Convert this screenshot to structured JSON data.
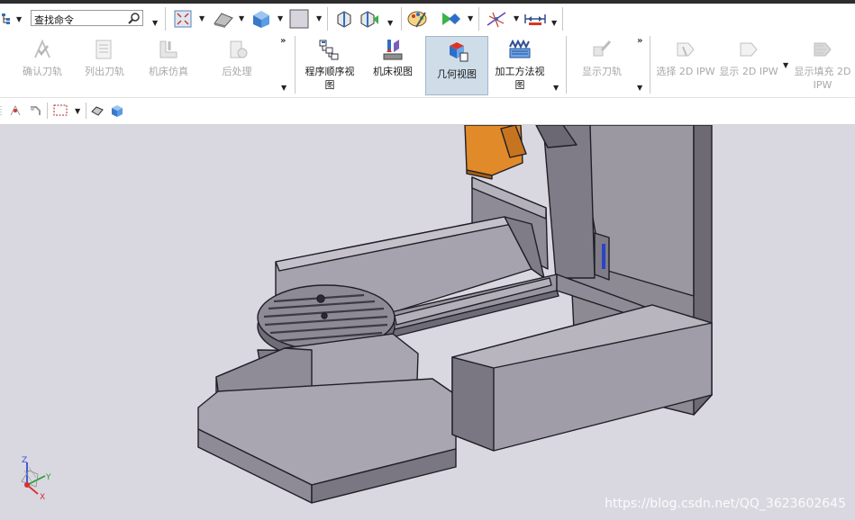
{
  "search": {
    "placeholder": "查找命令"
  },
  "ribbon": {
    "buttons": [
      {
        "label_1": "确认刀轨",
        "label_2": ""
      },
      {
        "label_1": "列出刀轨",
        "label_2": ""
      },
      {
        "label_1": "机床仿真",
        "label_2": ""
      },
      {
        "label_1": "后处理",
        "label_2": ""
      },
      {
        "label_1": "程序顺序视",
        "label_2": "图"
      },
      {
        "label_1": "机床视图",
        "label_2": ""
      },
      {
        "label_1": "几何视图",
        "label_2": ""
      },
      {
        "label_1": "加工方法视",
        "label_2": "图"
      },
      {
        "label_1": "显示刀轨",
        "label_2": ""
      },
      {
        "label_1": "选择 2D IPW",
        "label_2": ""
      },
      {
        "label_1": "显示 2D IPW",
        "label_2": ""
      },
      {
        "label_1": "显示填充 2D",
        "label_2": "IPW"
      }
    ]
  },
  "triad": {
    "z": "Z",
    "y": "Y",
    "x": "X"
  },
  "watermark": "https://blog.csdn.net/QQ_3623602645",
  "colors": {
    "viewport_bg": "#d9d7e0",
    "selected_bg": "#cfdde9",
    "machine_gray": "#8a8893",
    "spindle_orange": "#e08a2a"
  }
}
